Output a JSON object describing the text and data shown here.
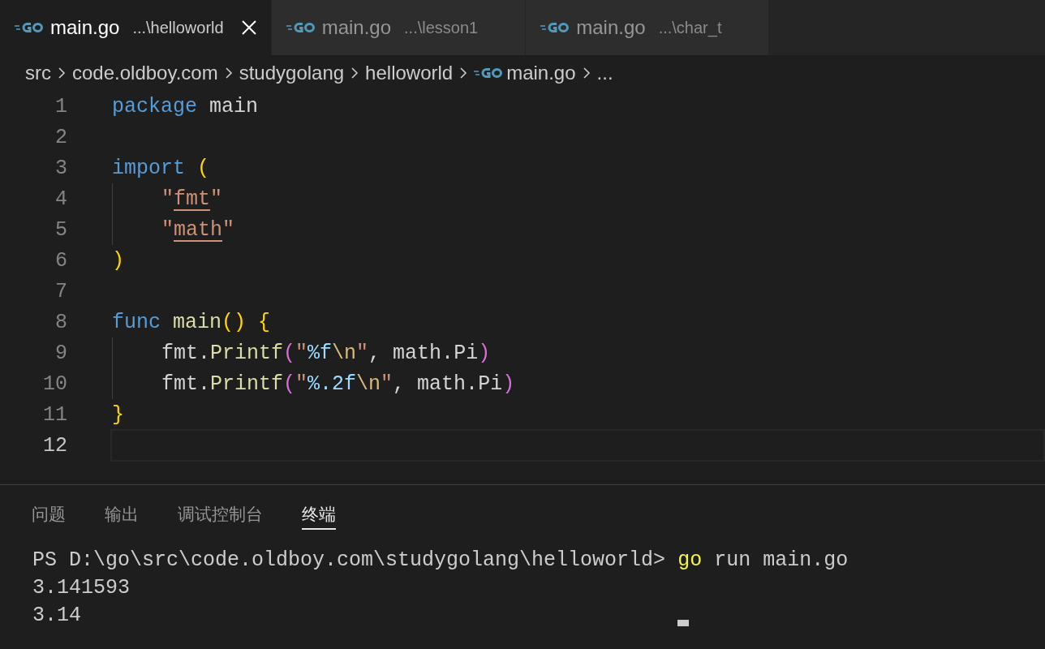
{
  "tabs": [
    {
      "label": "main.go",
      "path": "...\\helloworld",
      "selected": true
    },
    {
      "label": "main.go",
      "path": "...\\lesson1",
      "selected": false
    },
    {
      "label": "main.go",
      "path": "...\\char_t",
      "selected": false
    }
  ],
  "breadcrumbs": [
    {
      "label": "src",
      "kind": "folder"
    },
    {
      "label": "code.oldboy.com",
      "kind": "folder"
    },
    {
      "label": "studygolang",
      "kind": "folder"
    },
    {
      "label": "helloworld",
      "kind": "folder"
    },
    {
      "label": "main.go",
      "kind": "file"
    },
    {
      "label": "...",
      "kind": "more"
    }
  ],
  "editor": {
    "lines": [
      {
        "number": "1",
        "indent": false,
        "current": false,
        "tokens": [
          {
            "text": "package ",
            "kind": "keyword"
          },
          {
            "text": "main",
            "kind": "plain"
          }
        ]
      },
      {
        "number": "2",
        "indent": false,
        "current": false
      },
      {
        "number": "3",
        "indent": false,
        "current": false,
        "tokens": [
          {
            "text": "import ",
            "kind": "keyword"
          },
          {
            "text": "(",
            "kind": "bracket"
          }
        ]
      },
      {
        "number": "4",
        "indent": true,
        "current": false,
        "tokens": [
          {
            "text": "\"",
            "kind": "string"
          },
          {
            "text": "fmt",
            "kind": "link"
          },
          {
            "text": "\"",
            "kind": "string"
          }
        ]
      },
      {
        "number": "5",
        "indent": true,
        "current": false,
        "tokens": [
          {
            "text": "\"",
            "kind": "string"
          },
          {
            "text": "math",
            "kind": "link"
          },
          {
            "text": "\"",
            "kind": "string"
          }
        ]
      },
      {
        "number": "6",
        "indent": false,
        "current": false,
        "tokens": [
          {
            "text": ")",
            "kind": "bracket"
          }
        ]
      },
      {
        "number": "7",
        "indent": false,
        "current": false
      },
      {
        "number": "8",
        "indent": false,
        "current": false,
        "tokens": [
          {
            "text": "func ",
            "kind": "keyword"
          },
          {
            "text": "main",
            "kind": "function"
          },
          {
            "text": "() {",
            "kind": "bracket"
          }
        ]
      },
      {
        "number": "9",
        "indent": true,
        "current": false,
        "tokens": [
          {
            "text": "fmt.",
            "kind": "plain"
          },
          {
            "text": "Printf",
            "kind": "function"
          },
          {
            "text": "(",
            "kind": "bracket2"
          },
          {
            "text": "\"",
            "kind": "string"
          },
          {
            "text": "%f",
            "kind": "format"
          },
          {
            "text": "\\n",
            "kind": "escape"
          },
          {
            "text": "\"",
            "kind": "string"
          },
          {
            "text": ", math.Pi",
            "kind": "plain"
          },
          {
            "text": ")",
            "kind": "bracket2"
          }
        ]
      },
      {
        "number": "10",
        "indent": true,
        "current": false,
        "tokens": [
          {
            "text": "fmt.",
            "kind": "plain"
          },
          {
            "text": "Printf",
            "kind": "function"
          },
          {
            "text": "(",
            "kind": "bracket2"
          },
          {
            "text": "\"",
            "kind": "string"
          },
          {
            "text": "%.2f",
            "kind": "format"
          },
          {
            "text": "\\n",
            "kind": "escape"
          },
          {
            "text": "\"",
            "kind": "string"
          },
          {
            "text": ", math.Pi",
            "kind": "plain"
          },
          {
            "text": ")",
            "kind": "bracket2"
          }
        ]
      },
      {
        "number": "11",
        "indent": false,
        "current": false,
        "tokens": [
          {
            "text": "}",
            "kind": "bracket"
          }
        ]
      },
      {
        "number": "12",
        "indent": false,
        "current": true
      }
    ]
  },
  "panel": {
    "tabs": [
      {
        "label": "问题",
        "selected": false
      },
      {
        "label": "输出",
        "selected": false
      },
      {
        "label": "调试控制台",
        "selected": false
      },
      {
        "label": "终端",
        "selected": true
      }
    ],
    "terminal": {
      "command_line": [
        {
          "text": "PS D:\\go\\src\\code.oldboy.com\\studygolang\\helloworld> ",
          "kind": "prompt"
        },
        {
          "text": "go",
          "kind": "program"
        },
        {
          "text": " run main.go",
          "kind": "args"
        }
      ],
      "output": [
        "3.141593",
        "3.14"
      ]
    }
  }
}
